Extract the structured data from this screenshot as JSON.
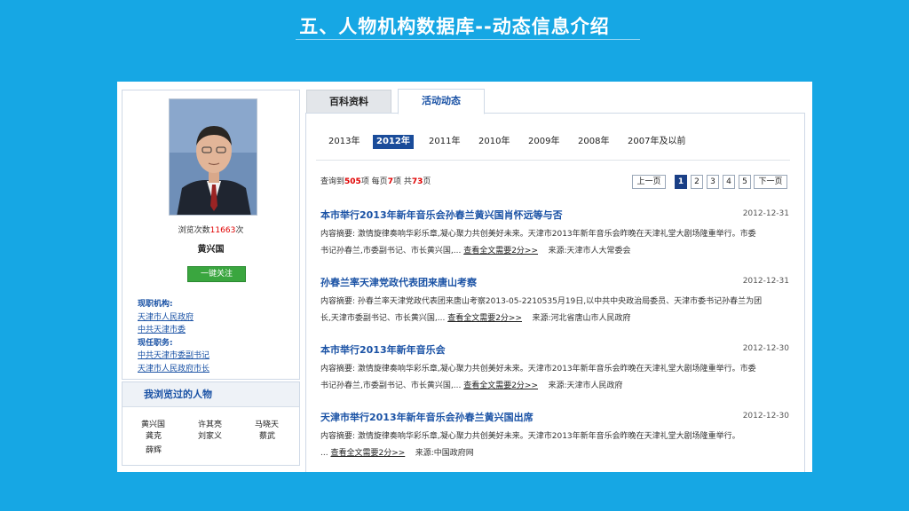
{
  "slide": {
    "title": "五、人物机构数据库--动态信息介绍"
  },
  "profile": {
    "views_prefix": "浏览次数",
    "views_count": "11663",
    "views_suffix": "次",
    "name": "黄兴国",
    "follow_label": "一键关注",
    "current_org_label": "现职机构:",
    "orgs": [
      "天津市人民政府",
      "中共天津市委"
    ],
    "current_post_label": "现任职务:",
    "posts": [
      "中共天津市委副书记",
      "天津市人民政府市长"
    ]
  },
  "browsed": {
    "title": "我浏览过的人物",
    "people": [
      "黄兴国",
      "许其亮",
      "马晓天",
      "龚克",
      "刘家义",
      "蔡武",
      "薛辉"
    ]
  },
  "tabs": {
    "baike": "百科资料",
    "activity": "活动动态"
  },
  "years": [
    "2013年",
    "2012年",
    "2011年",
    "2010年",
    "2009年",
    "2008年",
    "2007年及以前"
  ],
  "selected_year": "2012年",
  "summary": {
    "p1": "查询到",
    "total": "505",
    "p2": "项  每页",
    "per_page": "7",
    "p3": "项  共",
    "pages": "73",
    "p4": "页"
  },
  "pager": {
    "prev": "上一页",
    "pages": [
      "1",
      "2",
      "3",
      "4",
      "5"
    ],
    "current": "1",
    "next": "下一页"
  },
  "articles": [
    {
      "title": "本市举行2013年新年音乐会孙春兰黄兴国肖怀远等与否",
      "date": "2012-12-31",
      "line1": "内容摘要:  激情旋律奏响华彩乐章,凝心聚力共创美好未来。天津市2013年新年音乐会昨晚在天津礼堂大剧场隆重举行。市委",
      "line2": "书记孙春兰,市委副书记、市长黄兴国,...",
      "more": "查看全文需要2分>>",
      "source": "来源:天津市人大常委会"
    },
    {
      "title": "孙春兰率天津党政代表团来唐山考察",
      "date": "2012-12-31",
      "line1": "内容摘要:  孙春兰率天津党政代表团来唐山考察2013-05-2210535月19日,以中共中央政治局委员、天津市委书记孙春兰为团",
      "line2": "长,天津市委副书记、市长黄兴国,...",
      "more": "查看全文需要2分>>",
      "source": "来源:河北省唐山市人民政府"
    },
    {
      "title": "本市举行2013年新年音乐会",
      "date": "2012-12-30",
      "line1": "内容摘要:  激情旋律奏响华彩乐章,凝心聚力共创美好未来。天津市2013年新年音乐会昨晚在天津礼堂大剧场隆重举行。市委",
      "line2": "书记孙春兰,市委副书记、市长黄兴国,...",
      "more": "查看全文需要2分>>",
      "source": "来源:天津市人民政府"
    },
    {
      "title": "天津市举行2013年新年音乐会孙春兰黄兴国出席",
      "date": "2012-12-30",
      "line1": "内容摘要:      激情旋律奏响华彩乐章,凝心聚力共创美好未来。天津市2013年新年音乐会昨晚在天津礼堂大剧场隆重举行。",
      "line2": "   ...",
      "more": "查看全文需要2分>>",
      "source": "来源:中国政府网"
    }
  ]
}
